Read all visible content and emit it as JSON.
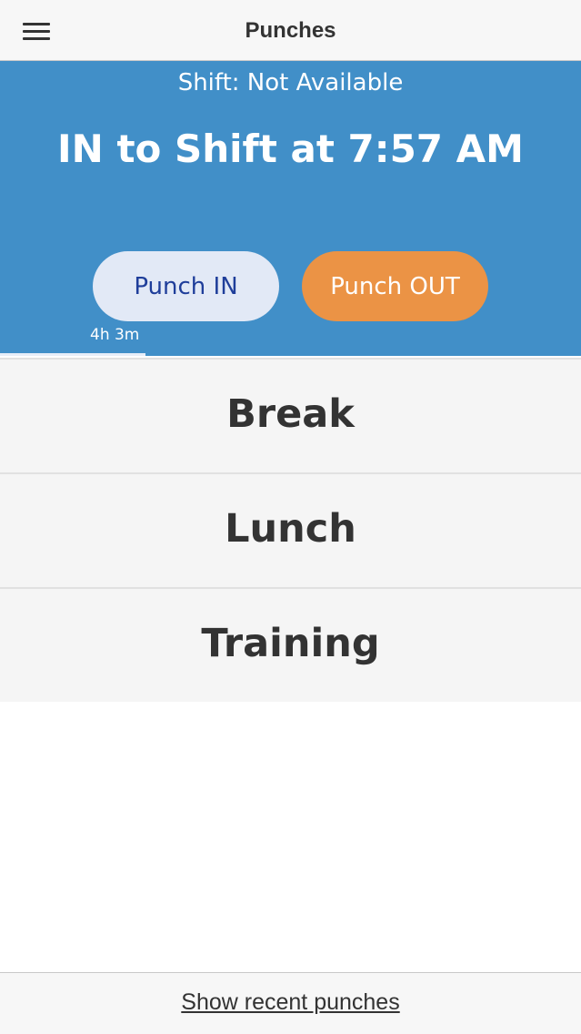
{
  "header": {
    "title": "Punches",
    "menu_icon": "hamburger-menu-icon"
  },
  "shift": {
    "status": "Shift: Not Available",
    "punch_time": "IN to Shift at 7:57 AM",
    "elapsed": "4h 3m",
    "elapsed_fraction": 0.25,
    "punch_in_label": "Punch IN",
    "punch_out_label": "Punch OUT"
  },
  "options": [
    {
      "label": "Break"
    },
    {
      "label": "Lunch"
    },
    {
      "label": "Training"
    }
  ],
  "footer": {
    "link_label": "Show recent punches"
  },
  "colors": {
    "panel_blue": "#418fc8",
    "punch_in_bg": "#e2e9f6",
    "punch_in_text": "#1f3e9a",
    "punch_out_bg": "#eb9345"
  }
}
